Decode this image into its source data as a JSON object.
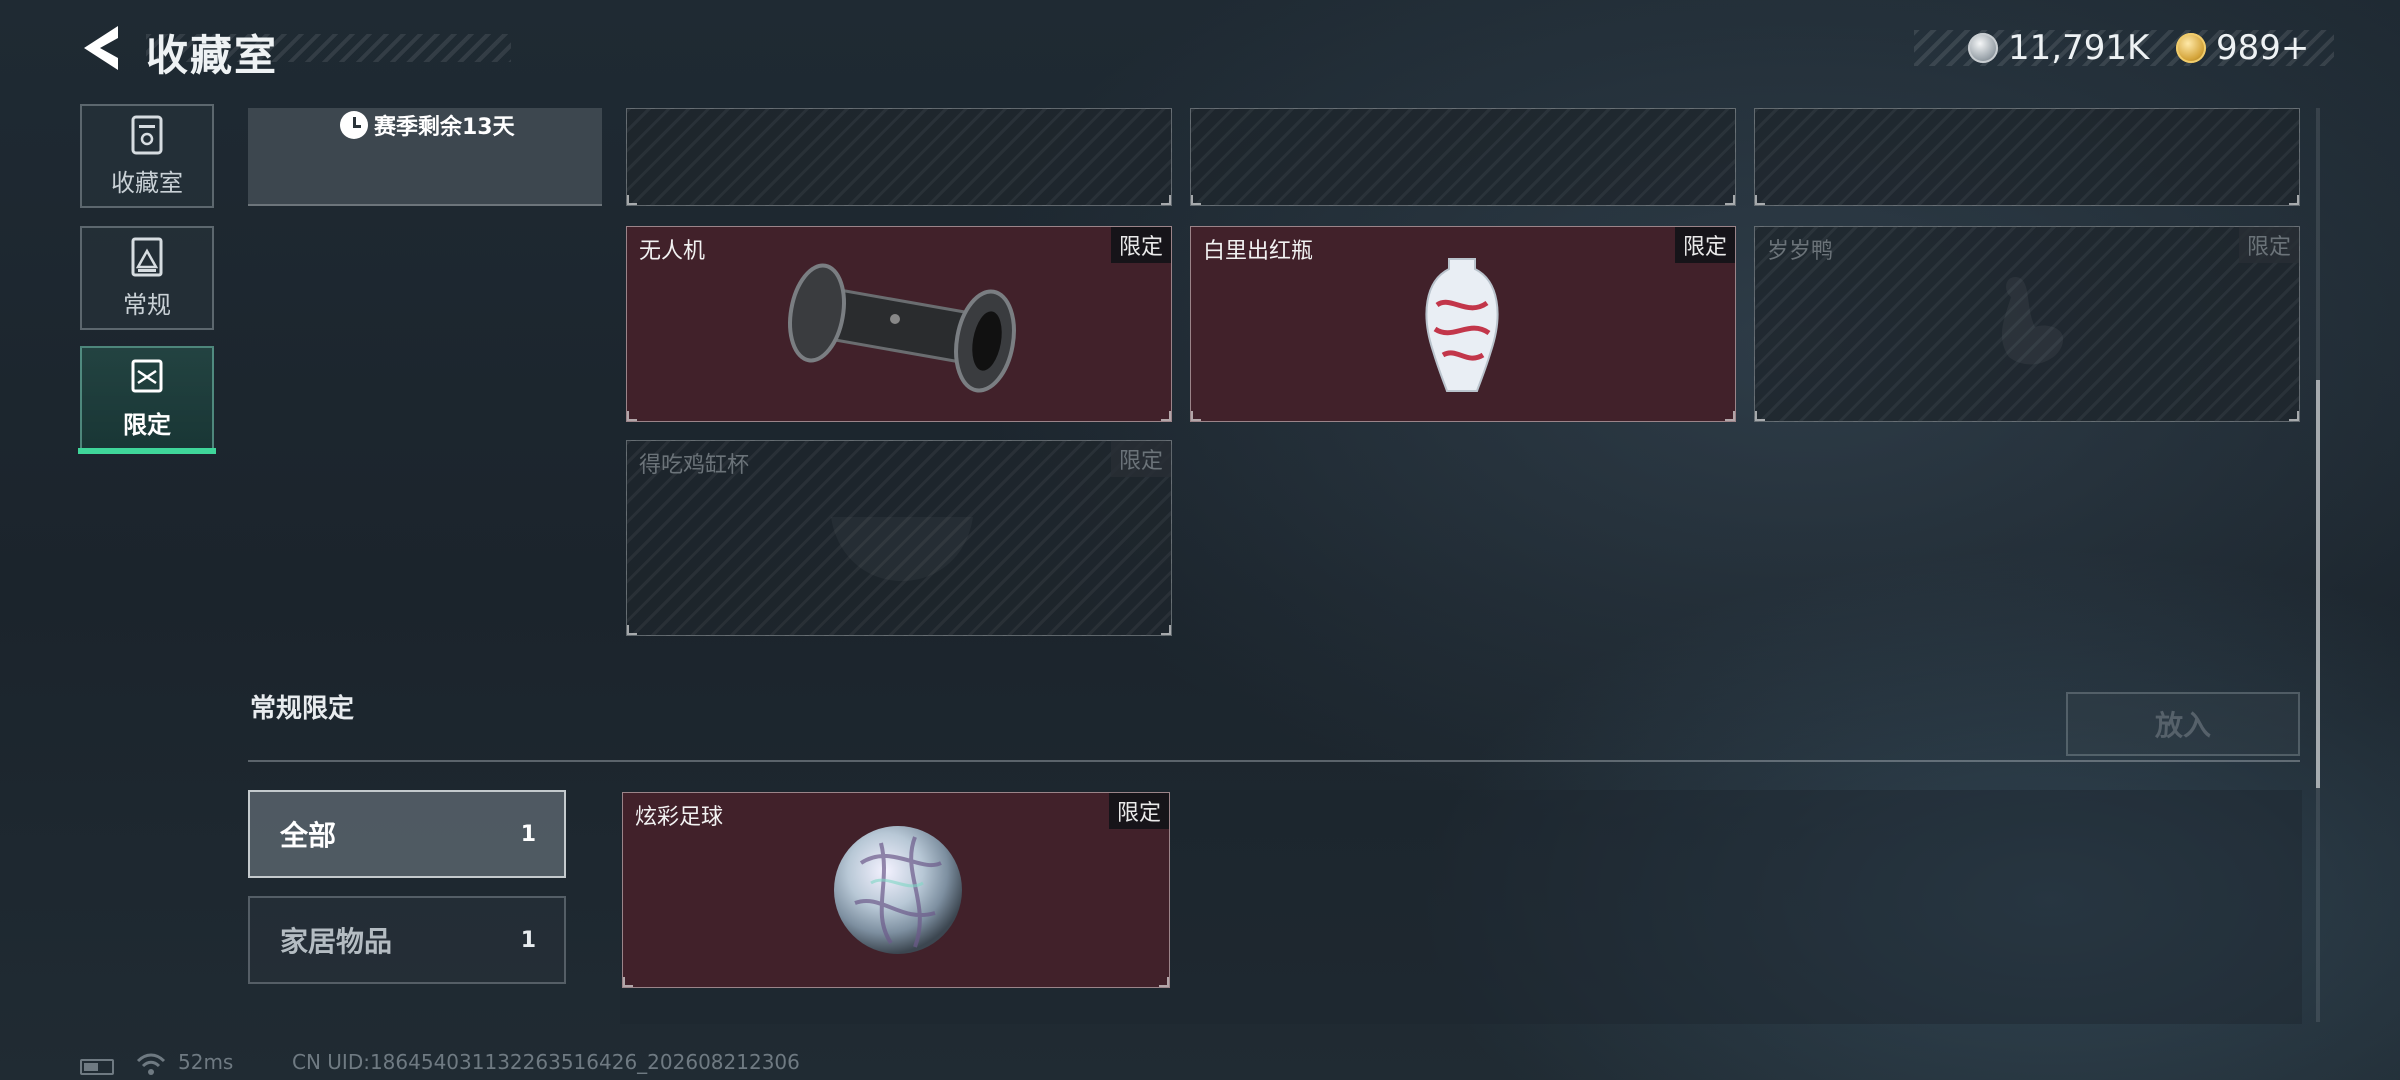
{
  "header": {
    "title": "收藏室",
    "back_icon": "chevron-left-icon",
    "currencies": [
      {
        "icon": "silver-coin-icon",
        "value": "11,791K"
      },
      {
        "icon": "gold-coin-icon",
        "value": "989+"
      }
    ]
  },
  "nav": [
    {
      "label": "收藏室",
      "icon": "cabinet-icon",
      "active": false
    },
    {
      "label": "常规",
      "icon": "photo-icon",
      "active": false
    },
    {
      "label": "限定",
      "icon": "limited-icon",
      "active": true
    }
  ],
  "season": {
    "label": "赛季剩余13天",
    "icon": "clock-icon"
  },
  "top_row_placeholders": 3,
  "limited_items": [
    {
      "name": "无人机",
      "badge": "限定",
      "owned": true
    },
    {
      "name": "白里出红瓶",
      "badge": "限定",
      "owned": true
    },
    {
      "name": "岁岁鸭",
      "badge": "限定",
      "owned": false
    },
    {
      "name": "得吃鸡缸杯",
      "badge": "限定",
      "owned": false
    }
  ],
  "regular_section": {
    "title": "常规限定",
    "put_button": "放入",
    "filters": [
      {
        "label": "全部",
        "count": "1",
        "active": true
      },
      {
        "label": "家居物品",
        "count": "1",
        "active": false
      }
    ],
    "items": [
      {
        "name": "炫彩足球",
        "badge": "限定",
        "owned": true
      }
    ]
  },
  "status_bar": {
    "latency": "52ms",
    "uid": "CN UID:18645403113226351642​6_202608212306"
  },
  "colors": {
    "accent_green": "#3fd69a",
    "owned_card_bg": "#41212a"
  }
}
